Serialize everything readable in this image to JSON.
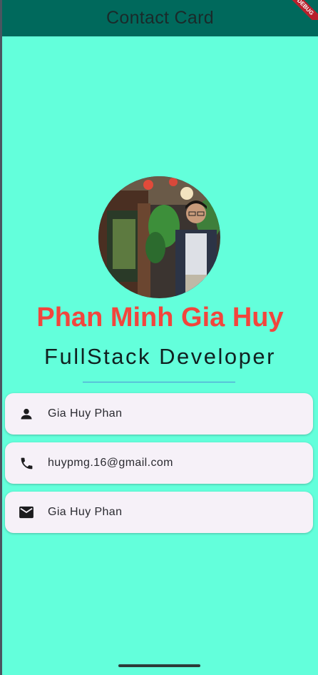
{
  "app_bar": {
    "title": "Contact Card",
    "color": "#00695c"
  },
  "debug_banner": {
    "label": "DEBUG"
  },
  "profile": {
    "photo": "profile-photo",
    "name": "Phan Minh Gia Huy",
    "title": "FullStack Developer",
    "name_color": "#f2453d"
  },
  "cards": [
    {
      "icon": "person-icon",
      "text": "Gia Huy Phan"
    },
    {
      "icon": "phone-icon",
      "text": "huypmg.16@gmail.com"
    },
    {
      "icon": "email-icon",
      "text": "Gia Huy Phan"
    }
  ],
  "background_color": "#63ffdb"
}
